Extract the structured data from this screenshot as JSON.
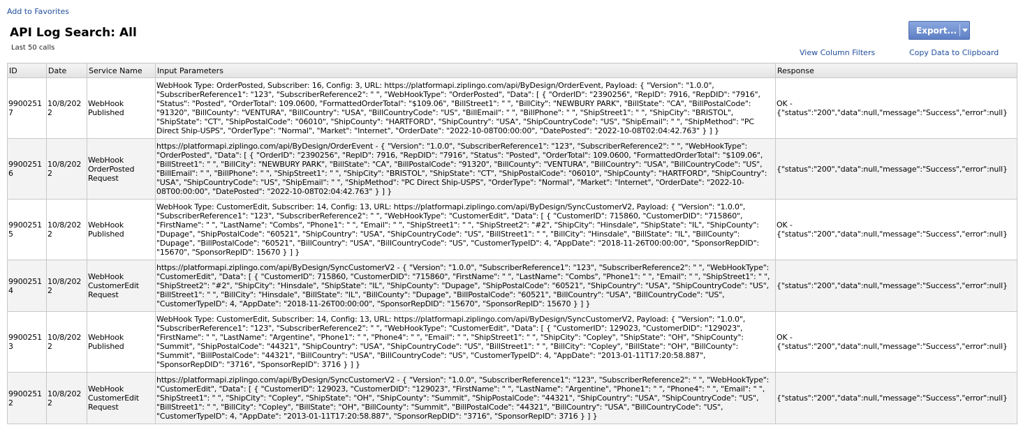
{
  "header": {
    "favorites_link": "Add to Favorites",
    "title": "API Log Search: All",
    "subtitle": "Last 50 calls",
    "export_label": "Export...",
    "view_filters_link": "View Column Filters",
    "copy_link": "Copy Data to Clipboard"
  },
  "colors": {
    "link": "#1f4e9c",
    "button": "#6f8fd0",
    "grid": "#c8c8c8",
    "row_alt": "#f3f3f3"
  },
  "table": {
    "columns": [
      "ID",
      "Date",
      "Service Name",
      "Input Parameters",
      "Response"
    ],
    "rows": [
      {
        "id": "99002517",
        "date": "10/8/2022",
        "service": "WebHook Published",
        "params": "WebHook Type: OrderPosted, Subscriber: 16, Config: 3, URL: https://platformapi.ziplingo.com/api/ByDesign/OrderEvent, Payload: { \"Version\": \"1.0.0\", \"SubscriberReference1\": \"123\", \"SubscriberReference2\": \"                 \", \"WebHookType\": \"OrderPosted\", \"Data\": [ { \"OrderID\": \"2390256\", \"RepID\": 7916, \"RepDID\": \"7916\", \"Status\": \"Posted\", \"OrderTotal\": 109.0600, \"FormattedOrderTotal\": \"$109.06\", \"BillStreet1\": \"                 \", \"BillCity\": \"NEWBURY PARK\", \"BillState\": \"CA\", \"BillPostalCode\": \"91320\", \"BillCounty\": \"VENTURA\", \"BillCountry\": \"USA\", \"BillCountryCode\": \"US\", \"BillEmail\": \"                 \", \"BillPhone\": \"                 \", \"ShipStreet1\": \"                 \", \"ShipCity\": \"BRISTOL\", \"ShipState\": \"CT\", \"ShipPostalCode\": \"06010\", \"ShipCounty\": \"HARTFORD\", \"ShipCountry\": \"USA\", \"ShipCountryCode\": \"US\", \"ShipEmail\": \"                 \", \"ShipMethod\": \"PC Direct Ship-USPS\", \"OrderType\": \"Normal\", \"Market\": \"Internet\", \"OrderDate\": \"2022-10-08T00:00:00\", \"DatePosted\": \"2022-10-08T02:04:42.763\" } ] }",
        "response": "OK - {\"status\":\"200\",\"data\":null,\"message\":\"Success\",\"error\":null}"
      },
      {
        "id": "99002516",
        "date": "10/8/2022",
        "service": "WebHook OrderPosted Request",
        "params": "https://platformapi.ziplingo.com/api/ByDesign/OrderEvent - { \"Version\": \"1.0.0\", \"SubscriberReference1\": \"123\", \"SubscriberReference2\": \"                 \", \"WebHookType\": \"OrderPosted\", \"Data\": [ { \"OrderID\": \"2390256\", \"RepID\": 7916, \"RepDID\": \"7916\", \"Status\": \"Posted\", \"OrderTotal\": 109.0600, \"FormattedOrderTotal\": \"$109.06\", \"BillStreet1\": \"                 \", \"BillCity\": \"NEWBURY PARK\", \"BillState\": \"CA\", \"BillPostalCode\": \"91320\", \"BillCounty\": \"VENTURA\", \"BillCountry\": \"USA\", \"BillCountryCode\": \"US\", \"BillEmail\": \"                 \", \"BillPhone\": \"                 \", \"ShipStreet1\": \"                 \", \"ShipCity\": \"BRISTOL\", \"ShipState\": \"CT\", \"ShipPostalCode\": \"06010\", \"ShipCounty\": \"HARTFORD\", \"ShipCountry\": \"USA\", \"ShipCountryCode\": \"US\", \"ShipEmail\": \"                 \", \"ShipMethod\": \"PC Direct Ship-USPS\", \"OrderType\": \"Normal\", \"Market\": \"Internet\", \"OrderDate\": \"2022-10-08T00:00:00\", \"DatePosted\": \"2022-10-08T02:04:42.763\" } ] }",
        "response": "{\"status\":\"200\",\"data\":null,\"message\":\"Success\",\"error\":null}"
      },
      {
        "id": "99002515",
        "date": "10/8/2022",
        "service": "WebHook Published",
        "params": "WebHook Type: CustomerEdit, Subscriber: 14, Config: 13, URL: https://platformapi.ziplingo.com/api/ByDesign/SyncCustomerV2, Payload: { \"Version\": \"1.0.0\", \"SubscriberReference1\": \"123\", \"SubscriberReference2\": \"                 \", \"WebHookType\": \"CustomerEdit\", \"Data\": [ { \"CustomerID\": 715860, \"CustomerDID\": \"715860\", \"FirstName\": \"                 \", \"LastName\": \"Combs\", \"Phone1\": \"                 \", \"Email\": \"                 \", \"ShipStreet1\": \"                 \", \"ShipStreet2\": \"#2\", \"ShipCity\": \"Hinsdale\", \"ShipState\": \"IL\", \"ShipCounty\": \"Dupage\", \"ShipPostalCode\": \"60521\", \"ShipCountry\": \"USA\", \"ShipCountryCode\": \"US\", \"BillStreet1\": \"                 \", \"BillCity\": \"Hinsdale\", \"BillState\": \"IL\", \"BillCounty\": \"Dupage\", \"BillPostalCode\": \"60521\", \"BillCountry\": \"USA\", \"BillCountryCode\": \"US\", \"CustomerTypeID\": 4, \"AppDate\": \"2018-11-26T00:00:00\", \"SponsorRepDID\": \"15670\", \"SponsorRepID\": 15670 } ] }",
        "response": "OK - {\"status\":\"200\",\"data\":null,\"message\":\"Success\",\"error\":null}"
      },
      {
        "id": "99002514",
        "date": "10/8/2022",
        "service": "WebHook CustomerEdit Request",
        "params": "https://platformapi.ziplingo.com/api/ByDesign/SyncCustomerV2 - { \"Version\": \"1.0.0\", \"SubscriberReference1\": \"123\", \"SubscriberReference2\": \"                 \", \"WebHookType\": \"CustomerEdit\", \"Data\": [ { \"CustomerID\": 715860, \"CustomerDID\": \"715860\", \"FirstName\": \"                 \", \"LastName\": \"Combs\", \"Phone1\": \"                 \", \"Email\": \"                 \", \"ShipStreet1\": \"                 \", \"ShipStreet2\": \"#2\", \"ShipCity\": \"Hinsdale\", \"ShipState\": \"IL\", \"ShipCounty\": \"Dupage\", \"ShipPostalCode\": \"60521\", \"ShipCountry\": \"USA\", \"ShipCountryCode\": \"US\", \"BillStreet1\": \"                 \", \"BillCity\": \"Hinsdale\", \"BillState\": \"IL\", \"BillCounty\": \"Dupage\", \"BillPostalCode\": \"60521\", \"BillCountry\": \"USA\", \"BillCountryCode\": \"US\", \"CustomerTypeID\": 4, \"AppDate\": \"2018-11-26T00:00:00\", \"SponsorRepDID\": \"15670\", \"SponsorRepID\": 15670 } ] }",
        "response": "{\"status\":\"200\",\"data\":null,\"message\":\"Success\",\"error\":null}"
      },
      {
        "id": "99002513",
        "date": "10/8/2022",
        "service": "WebHook Published",
        "params": "WebHook Type: CustomerEdit, Subscriber: 14, Config: 13, URL: https://platformapi.ziplingo.com/api/ByDesign/SyncCustomerV2, Payload: { \"Version\": \"1.0.0\", \"SubscriberReference1\": \"123\", \"SubscriberReference2\": \"                 \", \"WebHookType\": \"CustomerEdit\", \"Data\": [ { \"CustomerID\": 129023, \"CustomerDID\": \"129023\", \"FirstName\": \"                 \", \"LastName\": \"Argentine\", \"Phone1\": \"                 \", \"Phone4\": \"                 \", \"Email\": \"                 \", \"ShipStreet1\": \"                 \", \"ShipCity\": \"Copley\", \"ShipState\": \"OH\", \"ShipCounty\": \"Summit\", \"ShipPostalCode\": \"44321\", \"ShipCountry\": \"USA\", \"ShipCountryCode\": \"US\", \"BillStreet1\": \"                 \", \"BillCity\": \"Copley\", \"BillState\": \"OH\", \"BillCounty\": \"Summit\", \"BillPostalCode\": \"44321\", \"BillCountry\": \"USA\", \"BillCountryCode\": \"US\", \"CustomerTypeID\": 4, \"AppDate\": \"2013-01-11T17:20:58.887\", \"SponsorRepDID\": \"3716\", \"SponsorRepID\": 3716 } ] }",
        "response": "OK - {\"status\":\"200\",\"data\":null,\"message\":\"Success\",\"error\":null}"
      },
      {
        "id": "99002512",
        "date": "10/8/2022",
        "service": "WebHook CustomerEdit Request",
        "params": "https://platformapi.ziplingo.com/api/ByDesign/SyncCustomerV2 - { \"Version\": \"1.0.0\", \"SubscriberReference1\": \"123\", \"SubscriberReference2\": \"                 \", \"WebHookType\": \"CustomerEdit\", \"Data\": [ { \"CustomerID\": 129023, \"CustomerDID\": \"129023\", \"FirstName\": \"                 \", \"LastName\": \"Argentine\", \"Phone1\": \"                 \", \"Phone4\": \"                 \", \"Email\": \"                 \", \"ShipStreet1\": \"                 \", \"ShipCity\": \"Copley\", \"ShipState\": \"OH\", \"ShipCounty\": \"Summit\", \"ShipPostalCode\": \"44321\", \"ShipCountry\": \"USA\", \"ShipCountryCode\": \"US\", \"BillStreet1\": \"                 \", \"BillCity\": \"Copley\", \"BillState\": \"OH\", \"BillCounty\": \"Summit\", \"BillPostalCode\": \"44321\", \"BillCountry\": \"USA\", \"BillCountryCode\": \"US\", \"CustomerTypeID\": 4, \"AppDate\": \"2013-01-11T17:20:58.887\", \"SponsorRepDID\": \"3716\", \"SponsorRepID\": 3716 } ] }",
        "response": "{\"status\":\"200\",\"data\":null,\"message\":\"Success\",\"error\":null}"
      }
    ]
  }
}
